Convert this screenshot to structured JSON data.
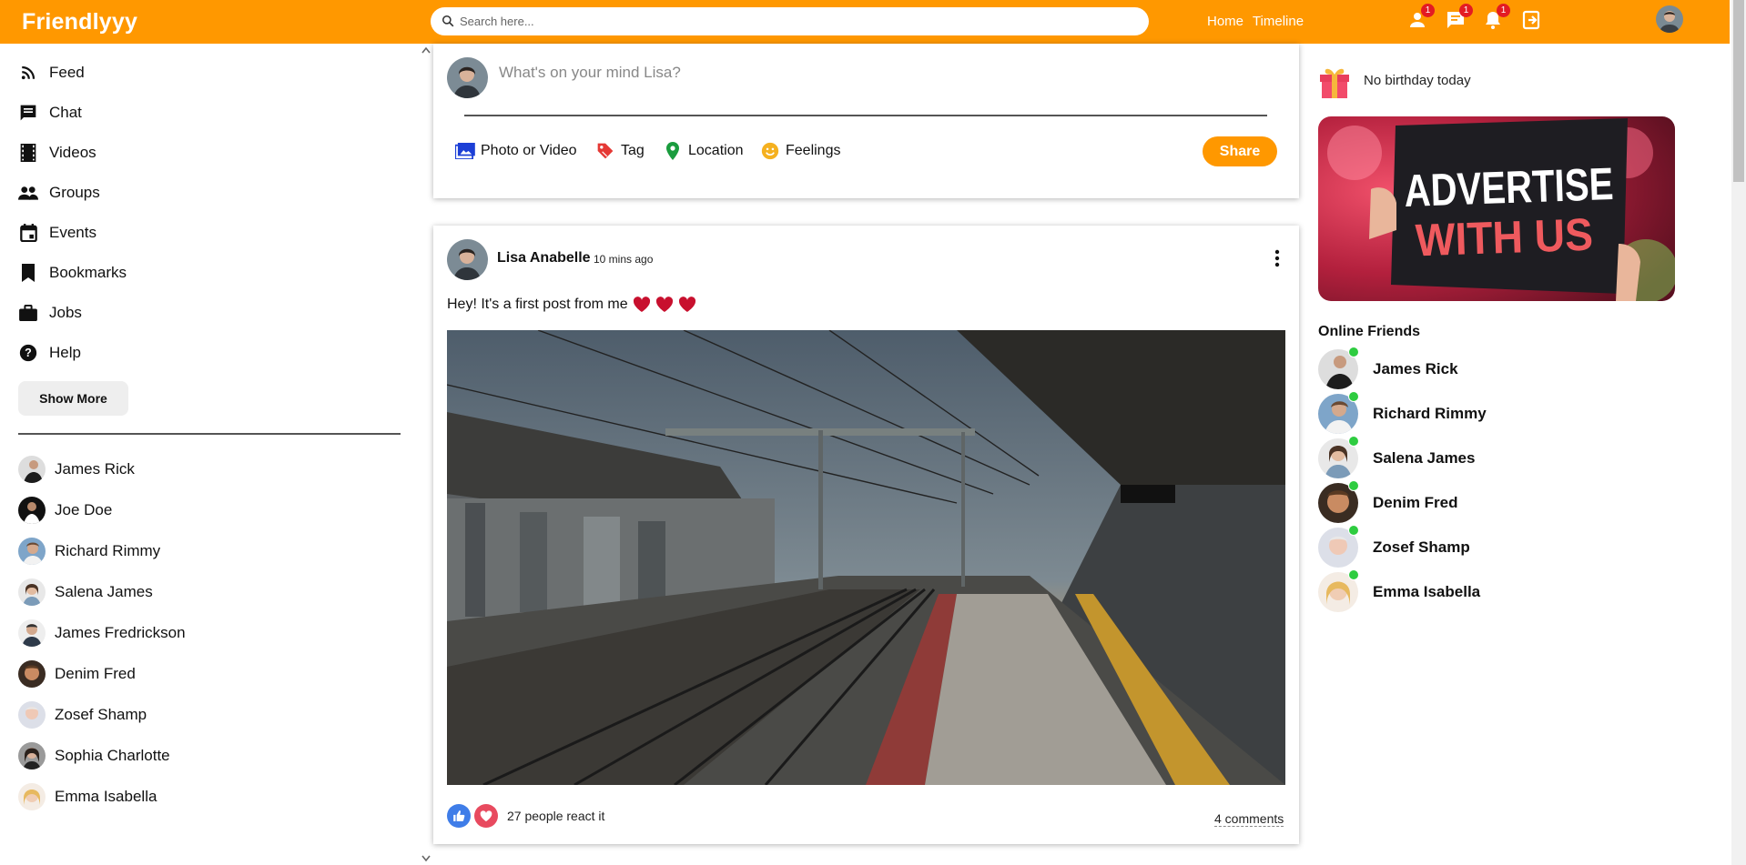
{
  "app": {
    "logo": "Friendlyyy",
    "search_placeholder": "Search here...",
    "nav_links": [
      "Home",
      "Timeline"
    ],
    "notifications": {
      "friends": "1",
      "messages": "1",
      "alerts": "1"
    },
    "accent_color": "#ff9800"
  },
  "sidebar": {
    "items": [
      {
        "label": "Feed",
        "icon": "rss-icon"
      },
      {
        "label": "Chat",
        "icon": "chat-icon"
      },
      {
        "label": "Videos",
        "icon": "film-icon"
      },
      {
        "label": "Groups",
        "icon": "group-icon"
      },
      {
        "label": "Events",
        "icon": "calendar-icon"
      },
      {
        "label": "Bookmarks",
        "icon": "bookmark-icon"
      },
      {
        "label": "Jobs",
        "icon": "briefcase-icon"
      },
      {
        "label": "Help",
        "icon": "help-icon"
      }
    ],
    "show_more": "Show More",
    "friends": [
      "James Rick",
      "Joe Doe",
      "Richard Rimmy",
      "Salena James",
      "James Fredrickson",
      "Denim Fred",
      "Zosef Shamp",
      "Sophia Charlotte",
      "Emma Isabella"
    ]
  },
  "share": {
    "placeholder": "What's on your mind Lisa?",
    "options": [
      "Photo or Video",
      "Tag",
      "Location",
      "Feelings"
    ],
    "button": "Share"
  },
  "post": {
    "author": "Lisa Anabelle",
    "time": "10 mins ago",
    "text": "Hey! It's a first post from me",
    "reactions": "27 people react it",
    "comments": "4 comments"
  },
  "rightbar": {
    "birthday": "No birthday today",
    "ad_line1": "ADVERTISE",
    "ad_line2": "WITH US",
    "online_title": "Online Friends",
    "online": [
      "James Rick",
      "Richard Rimmy",
      "Salena James",
      "Denim Fred",
      "Zosef Shamp",
      "Emma Isabella"
    ]
  }
}
